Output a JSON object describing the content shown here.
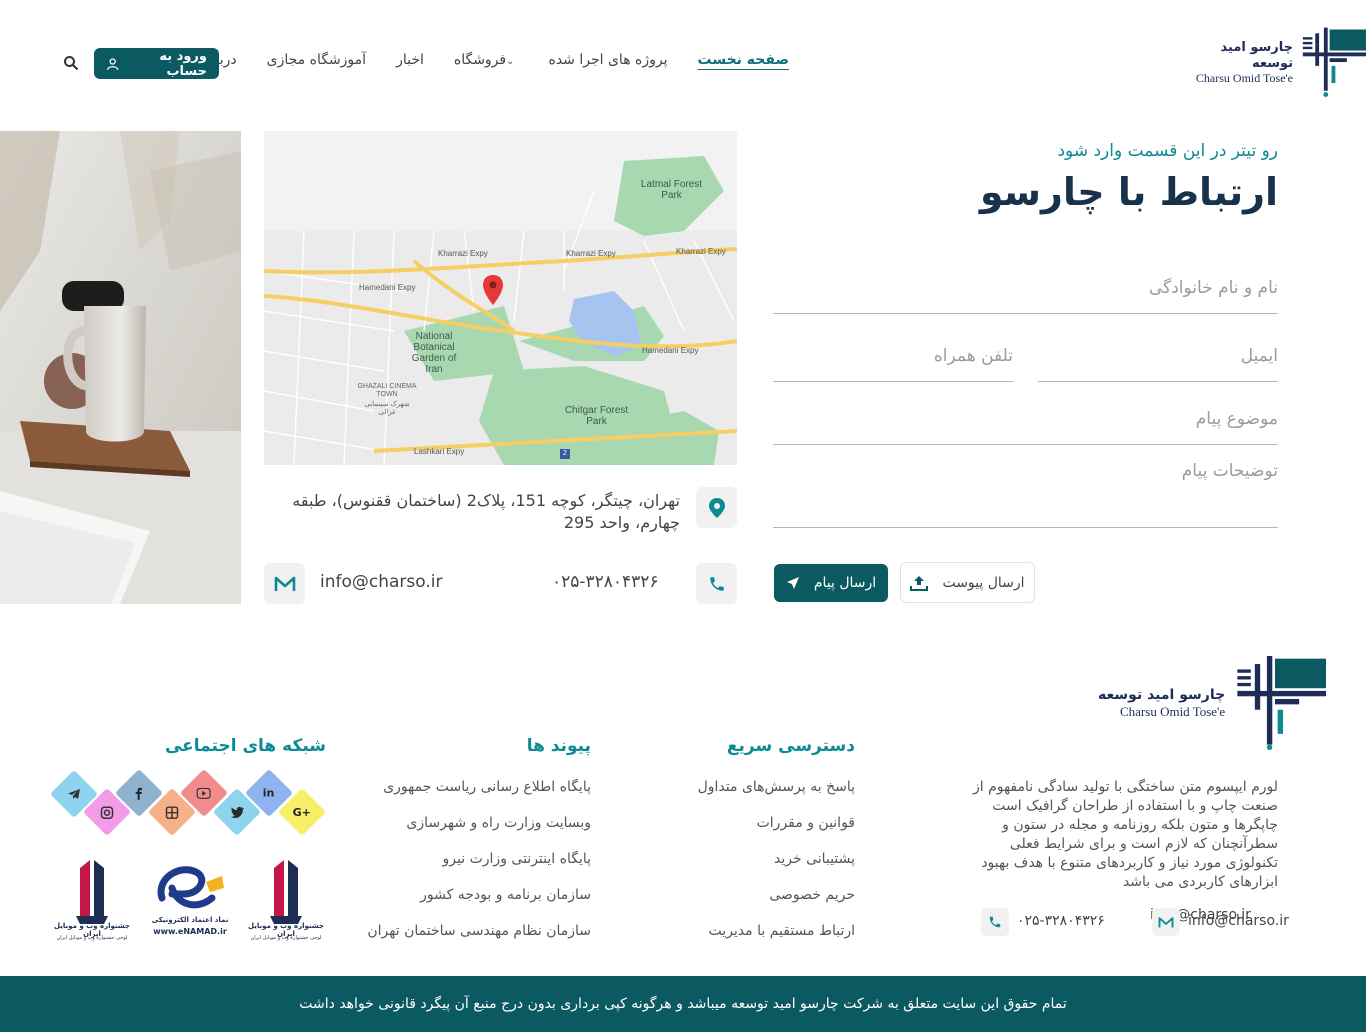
{
  "header": {
    "logo": {
      "fa": "چارسو امید توسعه",
      "en": "Charsu Omid Tose'e"
    },
    "nav": [
      {
        "label": "صفحه نخست",
        "active": true
      },
      {
        "label": "پروژه های اجرا شده"
      },
      {
        "label": "فروشگاه",
        "dropdown": true
      },
      {
        "label": "اخبار"
      },
      {
        "label": "آموزشگاه مجازی"
      },
      {
        "label": "درباره ما"
      }
    ],
    "login_label": "ورود به حساب"
  },
  "contact": {
    "kicker": "رو تیتر در این قسمت وارد شود",
    "title": "ارتباط با چارسو",
    "fields": {
      "name": "نام و نام خانوادگی",
      "email": "ایمیل",
      "phone": "تلفن همراه",
      "subject": "موضوع پیام",
      "message": "توضیحات پیام"
    },
    "send_label": "ارسال پیام",
    "attach_label": "ارسال پیوست"
  },
  "map": {
    "labels": {
      "latmal": "Latmal Forest Park",
      "botanical": "National Botanical Garden of Iran",
      "ghazali": "GHAZALI CINEMA TOWN",
      "ghazali_fa": "شهرک سینمایی غزالی",
      "chitgar": "Chitgar Forest Park",
      "kharrazi1": "Kharrazi Expy",
      "kharrazi2": "Kharrazi Expy",
      "kharrazi3": "Kharrazi Expy",
      "hamedani1": "Hamedani Expy",
      "hamedani2": "Hamedani Expy",
      "lashkari": "Lashkari Expy",
      "route": "2"
    }
  },
  "info": {
    "address": "تهران، چیتگر، کوچه 151، پلاک2 (ساختمان ققنوس)، طبقه چهارم، واحد 295",
    "phone": "۰۲۵-۳۲۸۰۴۳۲۶",
    "email": "info@charso.ir"
  },
  "footer": {
    "about": "لورم ایپسوم متن ساختگی با تولید سادگی نامفهوم از صنعت چاپ و با استفاده از طراحان گرافیک است چاپگرها و متون بلکه روزنامه و مجله در ستون و سطرآنچنان که لازم است و برای شرایط فعلی تکنولوژی مورد نیاز و کاربردهای متنوع با هدف بهبود ابزارهای کاربردی می باشد",
    "phone": "۰۲۵-۳۲۸۰۴۳۲۶",
    "email": "info@charso.ir",
    "quick_title": "دسترسی سریع",
    "quick_links": [
      "پاسخ به پرسش‌های متداول",
      "قوانین و مقررات",
      "پشتیبانی خرید",
      "حریم خصوصی",
      "ارتباط مستقیم با مدیریت"
    ],
    "links_title": "پیوند ها",
    "links": [
      "پایگاه اطلاع رسانی ریاست جمهوری",
      "وبسایت وزارت راه و شهرسازی",
      "پایگاه اینترنتی وزارت نیرو",
      "سازمان برنامه و بودجه کشور",
      "سازمان نظام مهندسی ساختمان تهران"
    ],
    "social_title": "شبکه های اجتماعی",
    "badges": {
      "festival_title": "جشنواره وب و موبایل ایران",
      "festival_sub": "لوحی جشنواره وب و موبایل ایران",
      "enamad_title": "نماد اعتماد الکترونیکی",
      "enamad_url": "www.eNAMAD.ir"
    },
    "copyright": "تمام حقوق این سایت متعلق به شرکت چارسو امید توسعه میباشد و هرگونه کپی برداری بدون درج منبع آن پیگرد قانونی خواهد داشت"
  },
  "colors": {
    "primary": "#0b5a62",
    "accent": "#0d8b94",
    "navy": "#1e2d55"
  }
}
